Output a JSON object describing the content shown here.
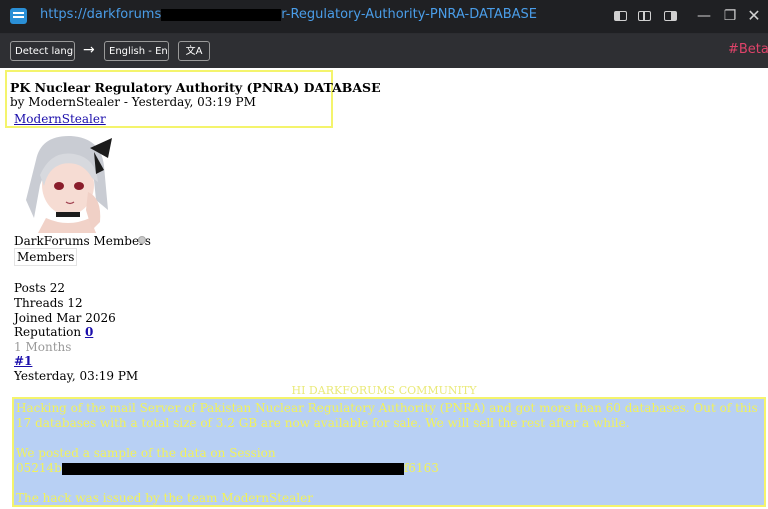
{
  "titlebar": {
    "url_prefix": "https://darkforums",
    "url_suffix": "r-Regulatory-Authority-PNRA-DATABASE"
  },
  "toolbar": {
    "detect_label": "Detect langua",
    "arrow": "→",
    "target_label": "English - Engl",
    "translate_icon": "文A",
    "beta_label": "#Beta"
  },
  "post": {
    "title": "PK Nuclear Regulatory Authority (PNRA) DATABASE",
    "byline": "by ModernStealer - Yesterday, 03:19 PM",
    "author": "ModernStealer",
    "group": "DarkForums Members",
    "group_badge": "Members",
    "posts": "Posts 22",
    "threads": "Threads 12",
    "joined": "Joined Mar 2026",
    "reputation_label": "Reputation ",
    "reputation_value": "0",
    "membership": "1 Months",
    "post_number": "#1",
    "timestamp": "Yesterday, 03:19 PM",
    "greeting": "HI DARKFORUMS COMMUNITY",
    "body_line1": "Hacking of the mail Server of Pakistan Nuclear Regulatory Authority (PNRA) and got more than 60 databases. Out of this 17 databases with a total size of 3.2 GB are now available for sale. We will sell the rest after a while.",
    "body_line2": "We posted a sample of the data on Session",
    "session_prefix": "05214b",
    "session_suffix": "f6163",
    "body_line3": "The hack was issued by the team ModernStealer"
  },
  "colors": {
    "highlight_border": "#f4f46c",
    "post_background": "#b8d0f4",
    "post_text": "#f2f25a",
    "link": "#1a0dab",
    "beta": "#e0436a",
    "url": "#4a9de8"
  },
  "icons": {
    "app": "browser-app-icon",
    "translate": "translate-icon",
    "window": [
      "layout-left-icon",
      "layout-split-icon",
      "layout-right-icon",
      "minimize-icon",
      "restore-icon",
      "close-icon"
    ]
  }
}
